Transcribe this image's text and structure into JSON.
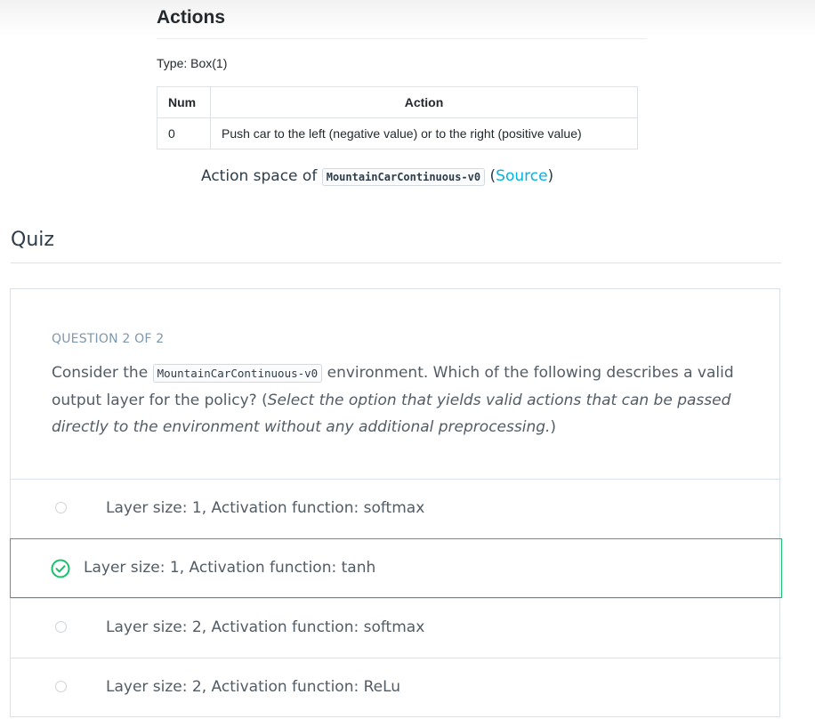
{
  "actions": {
    "heading": "Actions",
    "type_line": "Type: Box(1)",
    "table": {
      "headers": [
        "Num",
        "Action"
      ],
      "rows": [
        [
          "0",
          "Push car to the left (negative value) or to the right (positive value)"
        ]
      ]
    },
    "caption": {
      "prefix": "Action space of",
      "env_name": "MountainCarContinuous-v0",
      "open_paren": "(",
      "link_text": "Source",
      "close_paren": ")"
    }
  },
  "quiz": {
    "title": "Quiz",
    "counter": "QUESTION 2 OF 2",
    "question": {
      "before": "Consider the",
      "env_name": "MountainCarContinuous-v0",
      "after": "environment. Which of the following describes a valid output layer for the policy? (",
      "italic": "Select the option that yields valid actions that can be passed directly to the environment without any additional preprocessing.",
      "end": ")"
    },
    "options": [
      {
        "label": "Layer size: 1, Activation function: softmax",
        "selected": false
      },
      {
        "label": "Layer size: 1, Activation function: tanh",
        "selected": true
      },
      {
        "label": "Layer size: 2, Activation function: softmax",
        "selected": false
      },
      {
        "label": "Layer size: 2, Activation function: ReLu",
        "selected": false
      }
    ],
    "selected_color": "#15c26b",
    "link_color": "#02b3e4"
  }
}
